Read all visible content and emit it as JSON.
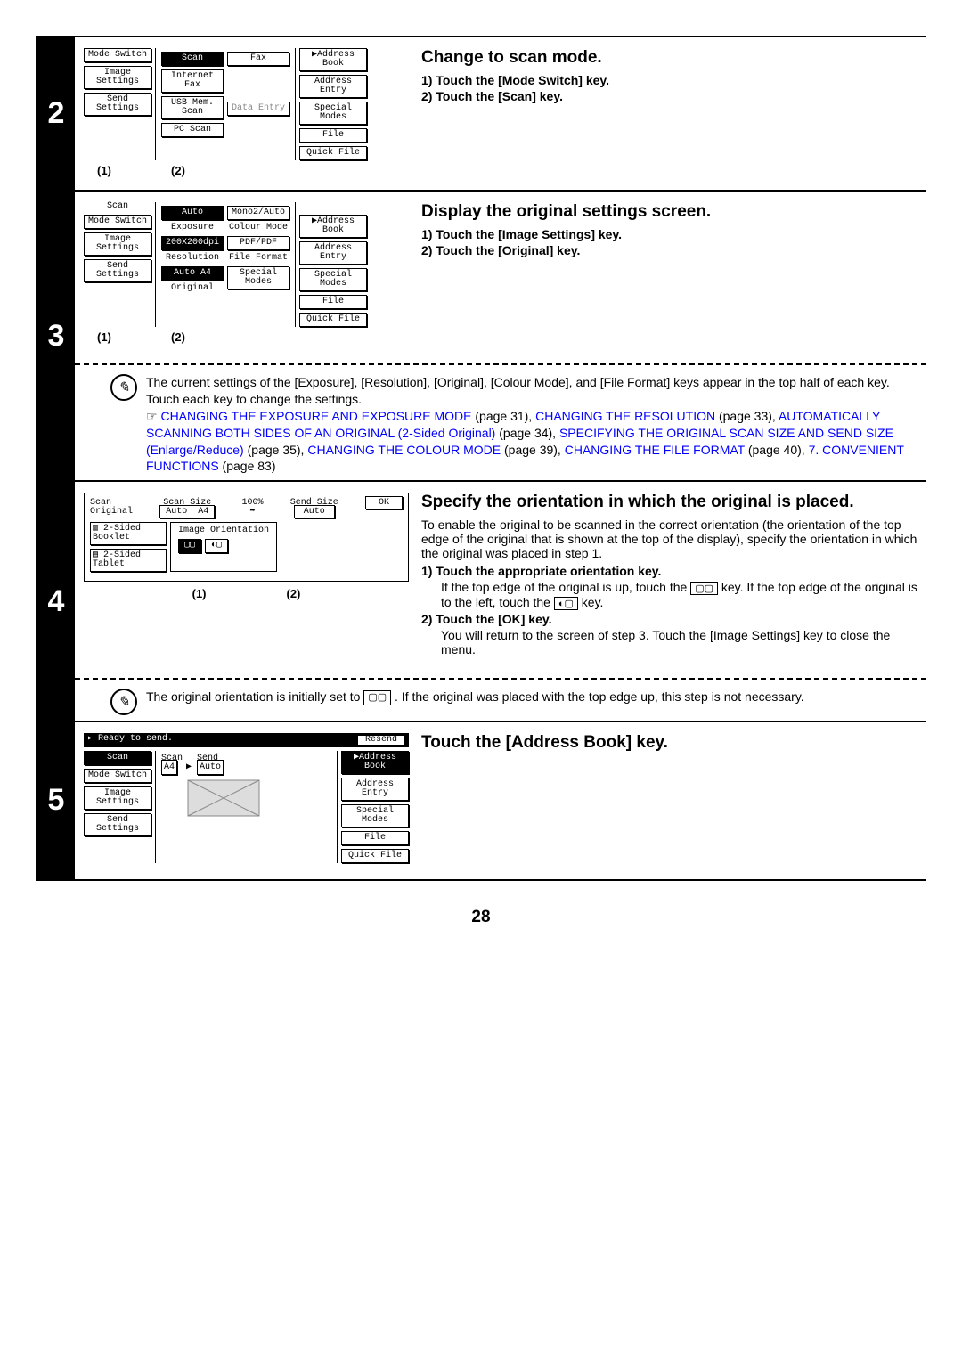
{
  "page_number": "28",
  "step2": {
    "num": "2",
    "title": "Change to scan mode.",
    "b1": "1)  Touch the [Mode Switch] key.",
    "b2": "2)  Touch the [Scan] key.",
    "l1": "(1)",
    "l2": "(2)",
    "panel": {
      "mode_switch": "Mode Switch",
      "image_settings": "Image\nSettings",
      "send_settings": "Send Settings",
      "scan": "Scan",
      "internet_fax": "Internet Fax",
      "usb": "USB Mem. Scan",
      "pc_scan": "PC Scan",
      "fax": "Fax",
      "data_entry": "Data Entry",
      "addr_book": "Address Book",
      "addr_entry": "Address Entry",
      "special": "Special Modes",
      "file": "File",
      "quick": "Quick File"
    }
  },
  "step3": {
    "num": "3",
    "title": "Display the original settings screen.",
    "b1": "1)  Touch the [Image Settings] key.",
    "b2": "2)  Touch the [Original] key.",
    "l1": "(1)",
    "l2": "(2)",
    "panel": {
      "scan": "Scan",
      "mode_switch": "Mode Switch",
      "image_settings": "Image\nSettings",
      "send_settings": "Send Settings",
      "auto": "Auto",
      "exposure": "Exposure",
      "res_val": "200X200dpi",
      "resolution": "Resolution",
      "auto_a4": "Auto    A4",
      "original": "Original",
      "mono": "Mono2/Auto",
      "colour": "Colour Mode",
      "pdf": "PDF/PDF",
      "file_format": "File Format",
      "special": "Special Modes",
      "addr_book": "Address Book",
      "addr_entry": "Address Entry",
      "special2": "Special Modes",
      "file": "File",
      "quick": "Quick File"
    },
    "note_p1": "The current settings of the [Exposure], [Resolution], [Original], [Colour Mode], and [File Format] keys appear in the top half of each key. Touch each key to change the settings.",
    "note_ptr": "☞",
    "links": {
      "a": "CHANGING THE EXPOSURE AND EXPOSURE MODE",
      "a_t": " (page 31), ",
      "b": "CHANGING THE RESOLUTION",
      "b_t": " (page 33), ",
      "c": "AUTOMATICALLY SCANNING BOTH SIDES OF AN ORIGINAL (2-Sided Original)",
      "c_t": " (page 34), ",
      "d": "SPECIFYING THE ORIGINAL SCAN SIZE AND SEND SIZE (Enlarge/Reduce)",
      "d_t": " (page 35), ",
      "e": "CHANGING THE COLOUR MODE",
      "e_t": " (page 39), ",
      "f": "CHANGING THE FILE FORMAT",
      "f_t": " (page 40), ",
      "g": "7. CONVENIENT FUNCTIONS",
      "g_t": " (page 83)"
    }
  },
  "step4": {
    "num": "4",
    "title": "Specify the orientation in which the original is placed.",
    "intro": "To enable the original to be scanned in the correct orientation (the orientation of the top edge of the original that is shown at the top of the display), specify the orientation in which the original was placed in step 1.",
    "b1": "1)  Touch the appropriate orientation key.",
    "b1a": "If the top edge of the original is up, touch the ",
    "b1b": " key. If the top edge of the original is to the left, touch the ",
    "b1c": " key.",
    "b2": "2)  Touch the [OK] key.",
    "b2a": "You will return to the screen of step 3. Touch the [Image Settings] key to close the menu.",
    "l1": "(1)",
    "l2": "(2)",
    "panel": {
      "scan": "Scan",
      "original": "Original",
      "scan_size": "Scan Size",
      "auto": "Auto",
      "a4": "A4",
      "arrow": "➡",
      "pct": "100%",
      "send_size": "Send Size",
      "auto2": "Auto",
      "ok": "OK",
      "two_book": "2-Sided\nBooklet",
      "two_tab": "2-Sided\nTablet",
      "img_ori": "Image Orientation"
    },
    "note": "The original orientation is initially set to ",
    "note2": " . If the original was placed with the top edge up, this step is not necessary."
  },
  "step5": {
    "num": "5",
    "title": "Touch the [Address Book] key.",
    "panel": {
      "ready": "Ready to send.",
      "resend": "Resend",
      "scan": "Scan",
      "mode_switch": "Mode Switch",
      "image_settings": "Image\nSettings",
      "send_settings": "Send Settings",
      "scan2": "Scan",
      "a4": "A4",
      "send": "Send",
      "auto": "Auto",
      "addr_book": "Address Book",
      "addr_entry": "Address Entry",
      "special": "Special Modes",
      "file": "File",
      "quick": "Quick File"
    }
  }
}
